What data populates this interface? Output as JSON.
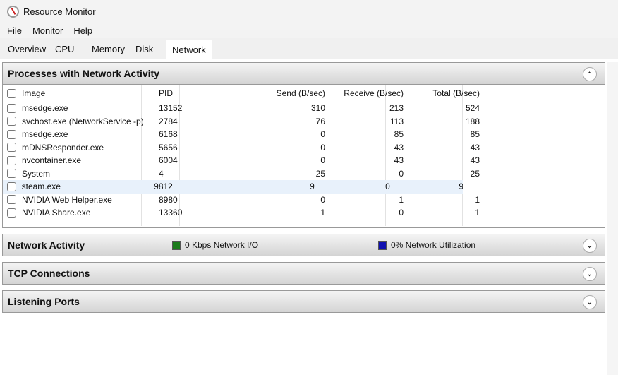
{
  "window": {
    "title": "Resource Monitor"
  },
  "menu": [
    "File",
    "Monitor",
    "Help"
  ],
  "tabs": [
    "Overview",
    "CPU",
    "Memory",
    "Disk",
    "Network"
  ],
  "active_tab": "Network",
  "processes": {
    "title": "Processes with Network Activity",
    "columns": [
      "Image",
      "PID",
      "Send (B/sec)",
      "Receive (B/sec)",
      "Total (B/sec)"
    ],
    "rows": [
      [
        "msedge.exe",
        "13152",
        "310",
        "213",
        "524"
      ],
      [
        "svchost.exe (NetworkService -p)",
        "2784",
        "76",
        "113",
        "188"
      ],
      [
        "msedge.exe",
        "6168",
        "0",
        "85",
        "85"
      ],
      [
        "mDNSResponder.exe",
        "5656",
        "0",
        "43",
        "43"
      ],
      [
        "nvcontainer.exe",
        "6004",
        "0",
        "43",
        "43"
      ],
      [
        "System",
        "4",
        "25",
        "0",
        "25"
      ],
      [
        "steam.exe",
        "9812",
        "9",
        "0",
        "9"
      ],
      [
        "NVIDIA Web Helper.exe",
        "8980",
        "0",
        "1",
        "1"
      ],
      [
        "NVIDIA Share.exe",
        "13360",
        "1",
        "0",
        "1"
      ]
    ],
    "highlighted_row": 6
  },
  "network_activity": {
    "title": "Network Activity",
    "io_label": "0 Kbps Network I/O",
    "io_color": "#1a7a1a",
    "util_label": "0% Network Utilization",
    "util_color": "#1010b0"
  },
  "tcp": {
    "title": "TCP Connections"
  },
  "ports": {
    "title": "Listening Ports"
  }
}
